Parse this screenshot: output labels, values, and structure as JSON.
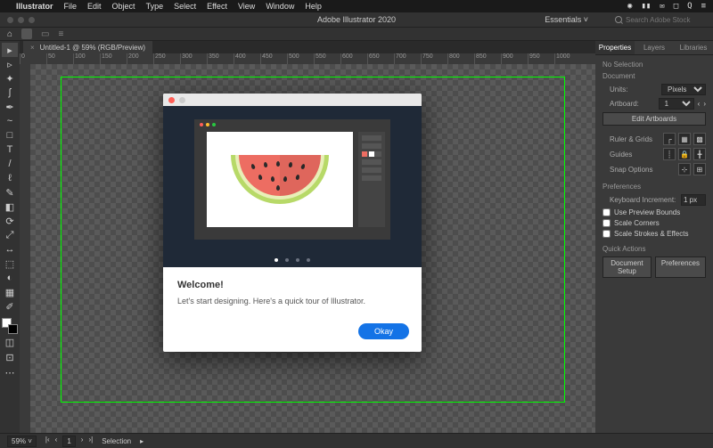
{
  "menubar": {
    "app": "Illustrator",
    "items": [
      "File",
      "Edit",
      "Object",
      "Type",
      "Select",
      "Effect",
      "View",
      "Window",
      "Help"
    ]
  },
  "titlebar": {
    "title": "Adobe Illustrator 2020",
    "workspace": "Essentials",
    "search_placeholder": "Search Adobe Stock"
  },
  "document": {
    "tab": "Untitled-1 @ 59% (RGB/Preview)",
    "tab_close": "×"
  },
  "panels": {
    "tabs": [
      "Properties",
      "Layers",
      "Libraries"
    ],
    "selection_status": "No Selection",
    "document_section": "Document",
    "units_label": "Units:",
    "units_value": "Pixels",
    "artboard_label": "Artboard:",
    "artboard_value": "1",
    "edit_artboards": "Edit Artboards",
    "ruler_grids": "Ruler & Grids",
    "guides": "Guides",
    "snap_options": "Snap Options",
    "preferences": "Preferences",
    "kb_increment_label": "Keyboard Increment:",
    "kb_increment_value": "1 px",
    "chk_preview": "Use Preview Bounds",
    "chk_corners": "Scale Corners",
    "chk_strokes": "Scale Strokes & Effects",
    "quick_actions": "Quick Actions",
    "doc_setup": "Document Setup",
    "prefs_btn": "Preferences"
  },
  "status": {
    "zoom": "59%",
    "page": "1",
    "mode": "Selection"
  },
  "modal": {
    "title": "Welcome!",
    "body": "Let's start designing. Here's a quick tour of Illustrator.",
    "ok": "Okay"
  },
  "ruler_ticks": [
    "0",
    "50",
    "100",
    "150",
    "200",
    "250",
    "300",
    "350",
    "400",
    "450",
    "500",
    "550",
    "600",
    "650",
    "700",
    "750",
    "800",
    "850",
    "900",
    "950",
    "1000"
  ],
  "tools": [
    {
      "name": "selection-tool",
      "glyph": "▸"
    },
    {
      "name": "direct-selection-tool",
      "glyph": "▹"
    },
    {
      "name": "magic-wand-tool",
      "glyph": "✦"
    },
    {
      "name": "lasso-tool",
      "glyph": "ʃ"
    },
    {
      "name": "pen-tool",
      "glyph": "✒"
    },
    {
      "name": "curvature-tool",
      "glyph": "~"
    },
    {
      "name": "rectangle-tool",
      "glyph": "□"
    },
    {
      "name": "type-tool",
      "glyph": "T"
    },
    {
      "name": "line-tool",
      "glyph": "/"
    },
    {
      "name": "paintbrush-tool",
      "glyph": "ℓ"
    },
    {
      "name": "shaper-tool",
      "glyph": "✎"
    },
    {
      "name": "eraser-tool",
      "glyph": "◧"
    },
    {
      "name": "rotate-tool",
      "glyph": "⟳"
    },
    {
      "name": "scale-tool",
      "glyph": "⤢"
    },
    {
      "name": "width-tool",
      "glyph": "↔"
    },
    {
      "name": "free-transform-tool",
      "glyph": "⬚"
    },
    {
      "name": "shape-builder-tool",
      "glyph": "◐"
    },
    {
      "name": "gradient-tool",
      "glyph": "▦"
    },
    {
      "name": "eyedropper-tool",
      "glyph": "✐"
    }
  ]
}
